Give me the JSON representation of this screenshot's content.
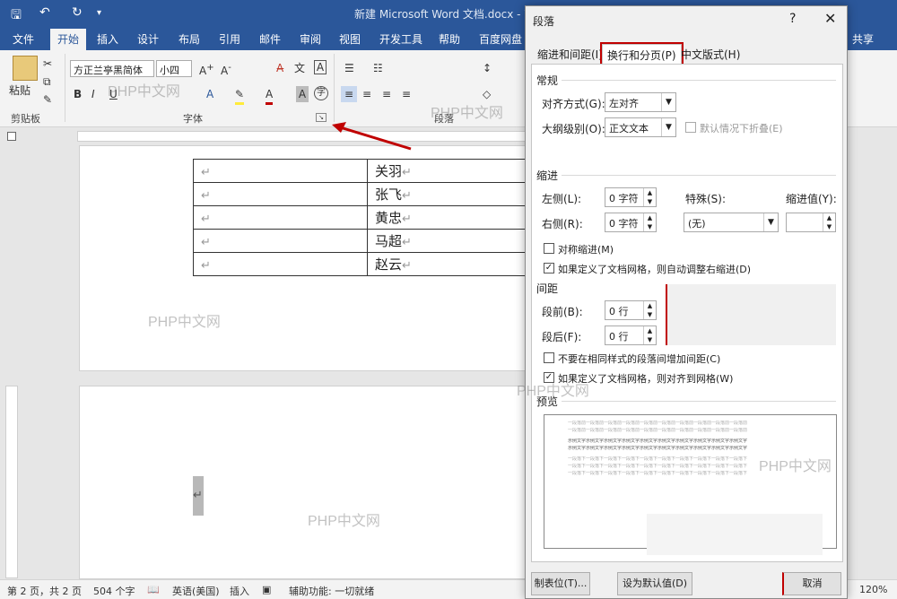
{
  "window": {
    "title": "新建 Microsoft Word 文档.docx - W",
    "user": "共享"
  },
  "ribbon_tabs": [
    "文件",
    "开始",
    "插入",
    "设计",
    "布局",
    "引用",
    "邮件",
    "审阅",
    "视图",
    "开发工具",
    "帮助",
    "百度网盘"
  ],
  "ribbon": {
    "paste_label": "粘贴",
    "font_name": "方正兰亭黑简体",
    "font_size": "小四",
    "group_clipboard": "剪贴板",
    "group_font": "字体",
    "group_paragraph": "段落"
  },
  "document": {
    "table_rows": [
      "关羽",
      "张飞",
      "黄忠",
      "马超",
      "赵云"
    ],
    "para_mark": "↵",
    "watermark": "PHP中文网"
  },
  "statusbar": {
    "page": "第 2 页，共 2 页",
    "words": "504 个字",
    "language": "英语(美国)",
    "mode": "插入",
    "accessibility": "辅助功能: 一切就绪",
    "zoom": "120%"
  },
  "dialog": {
    "title": "段落",
    "help": "?",
    "close": "✕",
    "tabs": [
      "缩进和间距(I)",
      "换行和分页(P)",
      "中文版式(H)"
    ],
    "general": {
      "header": "常规",
      "align_label": "对齐方式(G):",
      "align_value": "左对齐",
      "outline_label": "大纲级别(O):",
      "outline_value": "正文文本",
      "collapse_label": "默认情况下折叠(E)"
    },
    "indent": {
      "header": "缩进",
      "left_label": "左侧(L):",
      "left_value": "0 字符",
      "right_label": "右侧(R):",
      "right_value": "0 字符",
      "special_label": "特殊(S):",
      "special_value": "(无)",
      "by_label": "缩进值(Y):",
      "by_value": "",
      "mirror_label": "对称缩进(M)",
      "auto_adjust_label": "如果定义了文档网格，则自动调整右缩进(D)"
    },
    "spacing": {
      "header": "间距",
      "before_label": "段前(B):",
      "before_value": "0 行",
      "after_label": "段后(F):",
      "after_value": "0 行",
      "no_space_label": "不要在相同样式的段落间增加间距(C)",
      "snap_grid_label": "如果定义了文档网格，则对齐到网格(W)"
    },
    "preview": {
      "header": "预览",
      "prev_text": "一段落前一段落前一段落前一段落前一段落前一段落前一段落前一段落前一段落前一段落前",
      "sample_text": "示例文字示例文字示例文字示例文字示例文字示例文字示例文字示例文字示例文字示例文字",
      "next_text": "一段落下一段落下一段落下一段落下一段落下一段落下一段落下一段落下一段落下一段落下"
    },
    "buttons": {
      "tabs": "制表位(T)...",
      "default": "设为默认值(D)",
      "cancel": "取消"
    }
  }
}
